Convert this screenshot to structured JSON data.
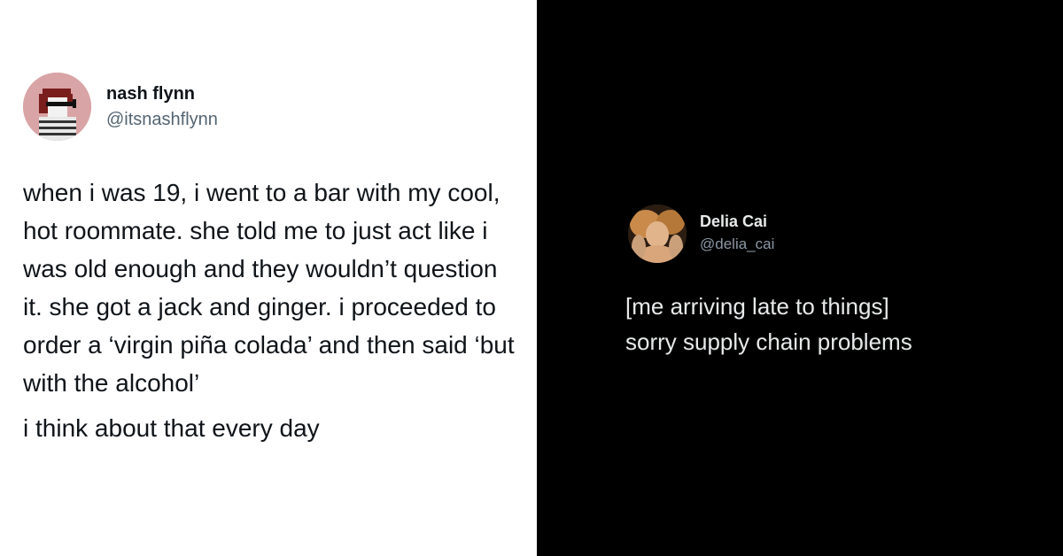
{
  "colors": {
    "light_bg": "#ffffff",
    "dark_bg": "#000000",
    "light_text": "#0f1419",
    "light_handle": "#536471",
    "dark_text": "#e7e9ea",
    "dark_handle": "#8b98a5"
  },
  "left_tweet": {
    "display_name": "nash flynn",
    "handle": "@itsnashflynn",
    "avatar_icon": "pixel-art-avatar",
    "paragraph_1": "when i was 19, i went to a bar with my cool, hot roommate. she told me to just act like i was old enough and they wouldn’t question it. she got a jack and ginger. i proceeded to order a ‘virgin piña colada’ and then said ‘but with the alcohol’",
    "paragraph_2": "i think about that every day"
  },
  "right_tweet": {
    "display_name": "Delia Cai",
    "handle": "@delia_cai",
    "avatar_icon": "photo-avatar",
    "line_1": "[me arriving late to things]",
    "line_2": "sorry supply chain problems"
  }
}
